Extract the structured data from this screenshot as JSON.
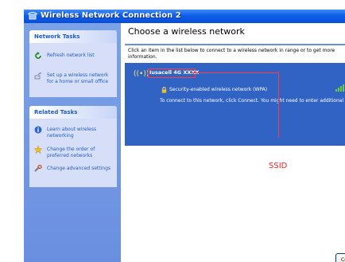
{
  "window": {
    "title": "Wireless Network Connection 2"
  },
  "sidebar": {
    "network_tasks": {
      "heading": "Network Tasks",
      "items": [
        {
          "label": "Refresh network list",
          "icon": "refresh-icon"
        },
        {
          "label": "Set up a wireless network for a home or small office",
          "icon": "wireless-setup-icon"
        }
      ]
    },
    "related_tasks": {
      "heading": "Related Tasks",
      "items": [
        {
          "label": "Learn about wireless networking",
          "icon": "info-icon"
        },
        {
          "label": "Change the order of preferred networks",
          "icon": "star-icon"
        },
        {
          "label": "Change advanced settings",
          "icon": "settings-icon"
        }
      ]
    }
  },
  "main": {
    "heading": "Choose a wireless network",
    "intro": "Click an item in the list below to connect to a wireless network in range or to get more information.",
    "network": {
      "ssid": "Iusacell 4G XXXX",
      "security": "Security-enabled wireless network (WPA)",
      "hint": "To connect to this network, click Connect. You might need to enter additional information."
    },
    "connect_label": "Connect"
  },
  "annotation": {
    "label": "SSID",
    "color": "#ff2020"
  },
  "colors": {
    "title_bar": "#0a54e2",
    "selected_network": "#3163c5",
    "task_link": "#215dc6"
  }
}
